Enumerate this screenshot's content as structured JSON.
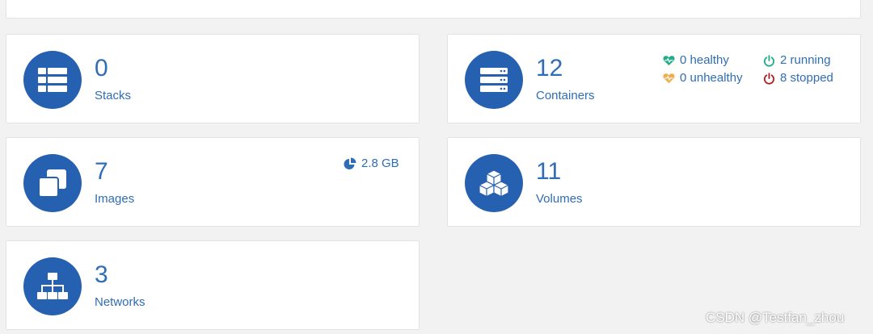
{
  "colors": {
    "accent": "#2560b1",
    "text": "#2f6db5",
    "healthy": "#23ae89",
    "unhealthy": "#f0ad4e",
    "running": "#23ae89",
    "stopped": "#ae2323"
  },
  "cards": {
    "stacks": {
      "count": "0",
      "label": "Stacks",
      "icon": "th-list-icon"
    },
    "containers": {
      "count": "12",
      "label": "Containers",
      "icon": "server-icon",
      "healthy": "0 healthy",
      "unhealthy": "0 unhealthy",
      "running": "2 running",
      "stopped": "8 stopped"
    },
    "images": {
      "count": "7",
      "label": "Images",
      "icon": "clone-icon",
      "size": "2.8 GB"
    },
    "volumes": {
      "count": "11",
      "label": "Volumes",
      "icon": "cubes-icon"
    },
    "networks": {
      "count": "3",
      "label": "Networks",
      "icon": "sitemap-icon"
    }
  },
  "watermark": "CSDN @Testfan_zhou"
}
